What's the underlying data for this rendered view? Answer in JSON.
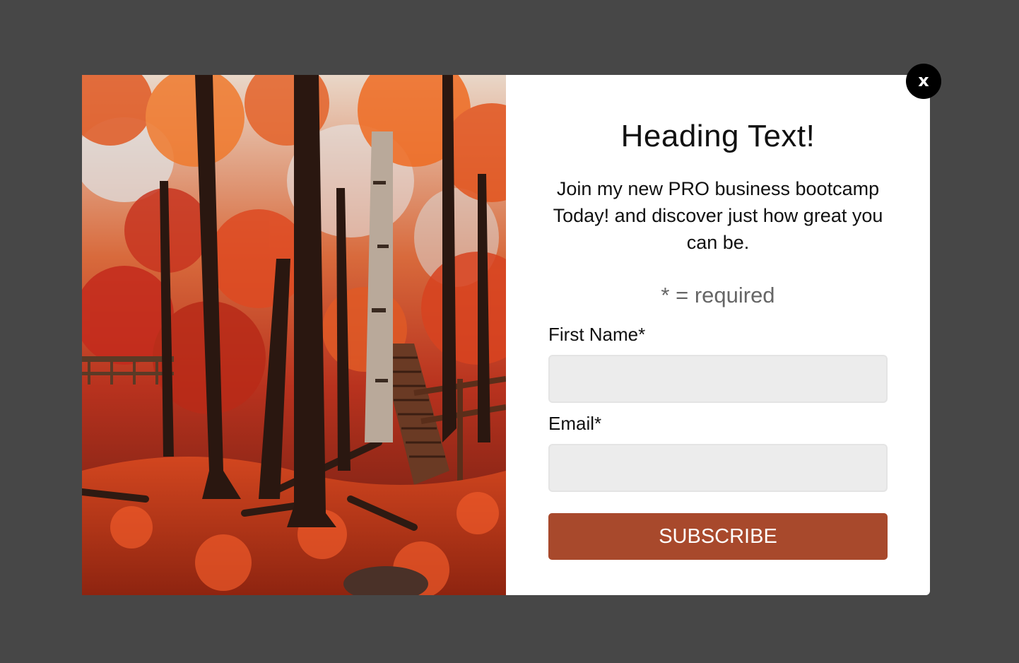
{
  "modal": {
    "heading": "Heading Text!",
    "description": "Join my new PRO business bootcamp Today! and discover just how great you can be.",
    "required_note": "* = required",
    "close_label": "x"
  },
  "form": {
    "first_name_label": "First Name*",
    "first_name_value": "",
    "email_label": "Email*",
    "email_value": "",
    "subscribe_label": "SUBSCRIBE"
  },
  "image": {
    "subject": "autumn forest with wooden stairs and red foliage"
  },
  "colors": {
    "overlay": "#474747",
    "button": "#a8492c",
    "input_bg": "#ececec"
  }
}
